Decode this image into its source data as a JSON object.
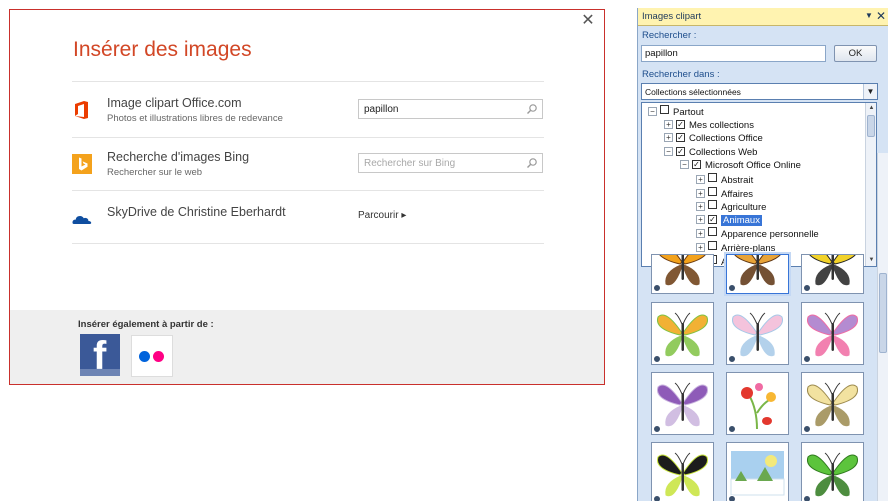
{
  "dialog": {
    "title": "Insérer des images",
    "close_glyph": "✕",
    "sources": [
      {
        "icon": "office-logo-icon",
        "title": "Image clipart Office.com",
        "subtitle": "Photos et illustrations libres de redevance",
        "search_value": "papillon",
        "search_placeholder": ""
      },
      {
        "icon": "bing-logo-icon",
        "title": "Recherche d'images Bing",
        "subtitle": "Rechercher sur le web",
        "search_value": "",
        "search_placeholder": "Rechercher sur Bing"
      },
      {
        "icon": "skydrive-cloud-icon",
        "title": "SkyDrive de Christine Eberhardt",
        "browse_label": "Parcourir ▸"
      }
    ],
    "footer": {
      "label": "Insérer également à partir de :",
      "facebook_glyph": "f"
    },
    "colors": {
      "accent": "#d24726",
      "facebook": "#3b5998",
      "flickr_blue": "#0063dc",
      "flickr_pink": "#ff0084"
    }
  },
  "pane": {
    "title": "Images clipart",
    "menu_glyph": "▼",
    "close_glyph": "✕",
    "search_label": "Rechercher :",
    "search_value": "papillon",
    "ok_label": "OK",
    "search_in_label": "Rechercher dans :",
    "collection_selected": "Collections sélectionnées",
    "tree": [
      {
        "label": "Partout",
        "level": 0,
        "toggle": "−",
        "checked": ""
      },
      {
        "label": "Mes collections",
        "level": 1,
        "toggle": "+",
        "checked": "☑"
      },
      {
        "label": "Collections Office",
        "level": 1,
        "toggle": "+",
        "checked": "☑"
      },
      {
        "label": "Collections Web",
        "level": 1,
        "toggle": "−",
        "checked": "✓"
      },
      {
        "label": "Microsoft Office Online",
        "level": 2,
        "toggle": "−",
        "checked": "✓"
      },
      {
        "label": "Abstrait",
        "level": 3,
        "toggle": "+",
        "checked": ""
      },
      {
        "label": "Affaires",
        "level": 3,
        "toggle": "+",
        "checked": ""
      },
      {
        "label": "Agriculture",
        "level": 3,
        "toggle": "+",
        "checked": ""
      },
      {
        "label": "Animaux",
        "level": 3,
        "toggle": "+",
        "checked": "✓",
        "selected": true
      },
      {
        "label": "Apparence personnelle",
        "level": 3,
        "toggle": "+",
        "checked": ""
      },
      {
        "label": "Arrière-plans",
        "level": 3,
        "toggle": "+",
        "checked": ""
      },
      {
        "label": "Arts",
        "level": 3,
        "toggle": "+",
        "checked": ""
      }
    ],
    "results": [
      {
        "name": "clipart-butterfly-orange",
        "main": "#f3a21c",
        "accent": "#6b3a10"
      },
      {
        "name": "clipart-butterfly-selected",
        "main": "#e8a338",
        "accent": "#5c3311"
      },
      {
        "name": "clipart-butterfly-yellow-black",
        "main": "#f2d229",
        "accent": "#222222"
      },
      {
        "name": "clipart-butterfly-colorful",
        "main": "#f2b134",
        "accent": "#7fc242"
      },
      {
        "name": "clipart-butterfly-pastel",
        "main": "#f4c3dc",
        "accent": "#a6c9e8"
      },
      {
        "name": "clipart-butterfly-flowers",
        "main": "#b48bd1",
        "accent": "#f06ba3"
      },
      {
        "name": "clipart-butterfly-purple",
        "main": "#8e5bb8",
        "accent": "#c9b3de"
      },
      {
        "name": "clipart-flowers-ladybug",
        "main": "#e3382e",
        "accent": "#7ab648"
      },
      {
        "name": "clipart-butterfly-cream",
        "main": "#f2e2a0",
        "accent": "#9c8a4e"
      },
      {
        "name": "clipart-butterfly-black-green",
        "main": "#1c1c1c",
        "accent": "#c7e33a"
      },
      {
        "name": "clipart-landscape-winter",
        "main": "#a9d0ef",
        "accent": "#f3e97a"
      },
      {
        "name": "clipart-butterfly-green",
        "main": "#5cc43c",
        "accent": "#2f7a1e"
      }
    ]
  }
}
